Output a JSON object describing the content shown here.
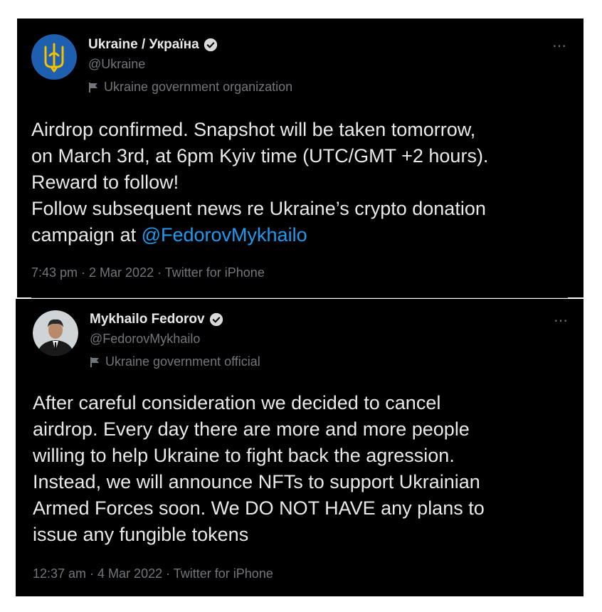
{
  "tweets": [
    {
      "display_name": "Ukraine / Україна",
      "handle": "@Ukraine",
      "label": "Ukraine government organization",
      "text_lines": [
        "Airdrop confirmed. Snapshot will be taken tomorrow,",
        "on March 3rd, at 6pm Kyiv time (UTC/GMT +2 hours).",
        "Reward to follow!",
        "Follow subsequent news re Ukraine’s crypto donation"
      ],
      "last_line_prefix": "campaign at ",
      "mention": "@FedorovMykhailo",
      "timestamp": "7:43 pm · 2 Mar 2022 · Twitter for iPhone",
      "avatar_color": "#1f5fb0",
      "trident_color": "#f2c200"
    },
    {
      "display_name": "Mykhailo Fedorov",
      "handle": "@FedorovMykhailo",
      "label": "Ukraine government official",
      "text_lines": [
        "After careful consideration we decided to cancel",
        "airdrop. Every day there are more and more people",
        "willing to help Ukraine to fight back the agression.",
        "Instead, we will announce NFTs to support Ukrainian",
        "Armed Forces soon. We DO NOT HAVE any plans to",
        "issue any fungible tokens"
      ],
      "timestamp": "12:37 am · 4 Mar 2022 · Twitter for iPhone"
    }
  ],
  "more_icon": "⋯",
  "icons": [
    "verified-badge-icon",
    "flag-icon",
    "more-icon",
    "trident-icon"
  ],
  "colors": {
    "background": "#000000",
    "text": "#e7e9ea",
    "muted": "#71767b",
    "link": "#1d9bf0"
  }
}
